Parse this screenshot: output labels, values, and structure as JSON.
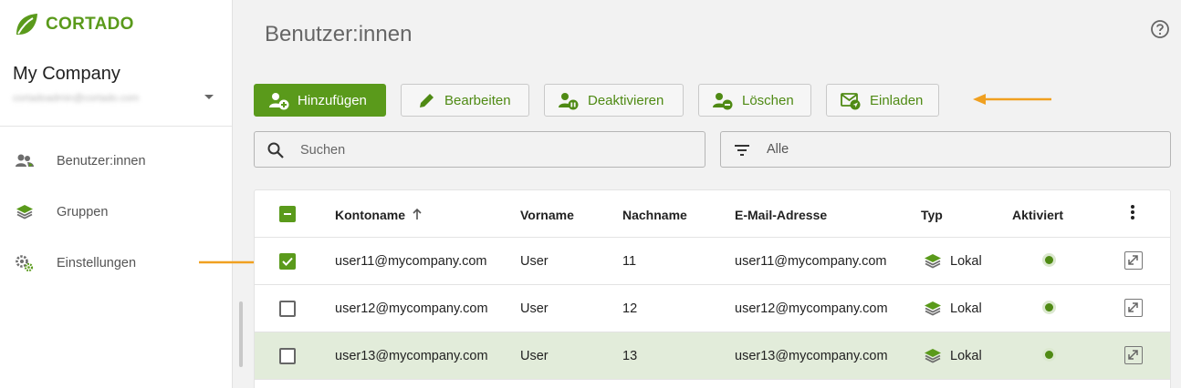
{
  "app": {
    "logo_text": "CORTADO",
    "brand_color": "#5a9a1b",
    "accent_arrow_color": "#f0a020"
  },
  "sidebar": {
    "company": "My Company",
    "email": "cortadoadmin@cortado.com",
    "items": [
      {
        "label": "Benutzer:innen",
        "icon": "users-icon"
      },
      {
        "label": "Gruppen",
        "icon": "layers-icon"
      },
      {
        "label": "Einstellungen",
        "icon": "settings-icon"
      }
    ]
  },
  "header": {
    "title": "Benutzer:innen",
    "help_icon": "help-icon"
  },
  "toolbar": {
    "add": "Hinzufügen",
    "edit": "Bearbeiten",
    "deactivate": "Deaktivieren",
    "delete": "Löschen",
    "invite": "Einladen"
  },
  "search": {
    "placeholder": "Suchen"
  },
  "filter": {
    "value": "Alle"
  },
  "table": {
    "columns": [
      "Kontoname",
      "Vorname",
      "Nachname",
      "E-Mail-Adresse",
      "Typ",
      "Aktiviert"
    ],
    "sort_column": "Kontoname",
    "sort_direction": "ascending",
    "rows": [
      {
        "account": "user11@mycompany.com",
        "first": "User",
        "last": "11",
        "email": "user11@mycompany.com",
        "type": "Lokal",
        "active": true,
        "checked": true,
        "highlighted": false
      },
      {
        "account": "user12@mycompany.com",
        "first": "User",
        "last": "12",
        "email": "user12@mycompany.com",
        "type": "Lokal",
        "active": true,
        "checked": false,
        "highlighted": false
      },
      {
        "account": "user13@mycompany.com",
        "first": "User",
        "last": "13",
        "email": "user13@mycompany.com",
        "type": "Lokal",
        "active": true,
        "checked": false,
        "highlighted": true
      }
    ]
  }
}
